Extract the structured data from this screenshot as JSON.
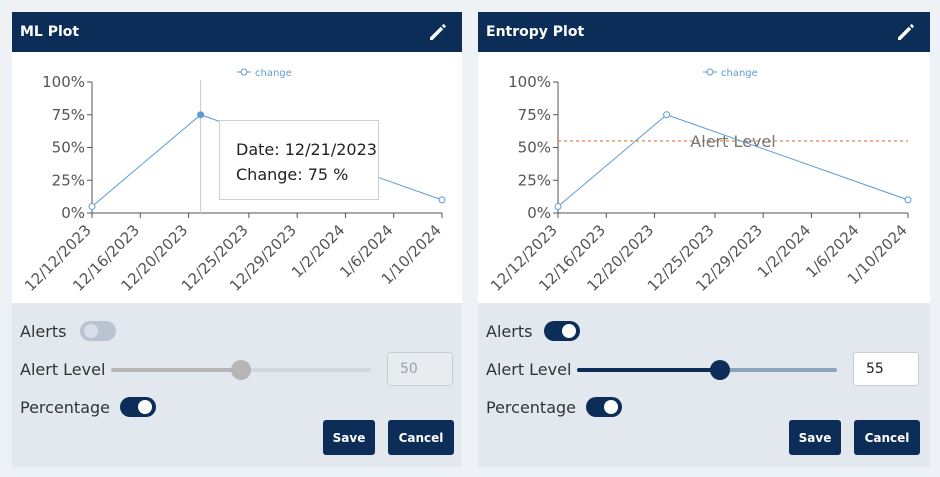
{
  "panels": [
    {
      "title": "ML Plot",
      "edit_icon": "pencil-icon",
      "controls": {
        "alerts_label": "Alerts",
        "alerts_on": false,
        "alert_level_label": "Alert Level",
        "alert_level_value": "50",
        "slider_fraction": 0.5,
        "slider_disabled": true,
        "percentage_label": "Percentage",
        "percentage_on": true,
        "save_label": "Save",
        "cancel_label": "Cancel"
      },
      "tooltip": {
        "date_line": "Date: 12/21/2023",
        "change_line": "Change: 75 %"
      }
    },
    {
      "title": "Entropy Plot",
      "edit_icon": "pencil-icon",
      "controls": {
        "alerts_label": "Alerts",
        "alerts_on": true,
        "alert_level_label": "Alert Level",
        "alert_level_value": "55",
        "slider_fraction": 0.55,
        "slider_disabled": false,
        "percentage_label": "Percentage",
        "percentage_on": true,
        "save_label": "Save",
        "cancel_label": "Cancel"
      }
    }
  ],
  "chart_data": [
    {
      "type": "line",
      "legend": [
        "change"
      ],
      "legend_position": "top-center",
      "series": [
        {
          "name": "change",
          "color": "#5b9bd5",
          "points": [
            {
              "x": "12/12/2023",
              "y": 5
            },
            {
              "x": "12/21/2023",
              "y": 75
            },
            {
              "x": "1/10/2024",
              "y": 10
            }
          ]
        }
      ],
      "x_ticks": [
        "12/12/2023",
        "12/16/2023",
        "12/20/2023",
        "12/25/2023",
        "12/29/2023",
        "1/2/2024",
        "1/6/2024",
        "1/10/2024"
      ],
      "y_ticks": [
        "0%",
        "25%",
        "50%",
        "75%",
        "100%"
      ],
      "ylim": [
        0,
        100
      ],
      "grid": false,
      "highlighted_point": {
        "x": "12/21/2023",
        "y": 75
      },
      "tooltip_lines": [
        "Date: 12/21/2023",
        "Change: 75 %"
      ]
    },
    {
      "type": "line",
      "legend": [
        "change"
      ],
      "legend_position": "top-center",
      "series": [
        {
          "name": "change",
          "color": "#5b9bd5",
          "points": [
            {
              "x": "12/12/2023",
              "y": 5
            },
            {
              "x": "12/21/2023",
              "y": 75
            },
            {
              "x": "1/10/2024",
              "y": 10
            }
          ]
        }
      ],
      "x_ticks": [
        "12/12/2023",
        "12/16/2023",
        "12/20/2023",
        "12/25/2023",
        "12/29/2023",
        "1/2/2024",
        "1/6/2024",
        "1/10/2024"
      ],
      "y_ticks": [
        "0%",
        "25%",
        "50%",
        "75%",
        "100%"
      ],
      "ylim": [
        0,
        100
      ],
      "grid": false,
      "threshold": {
        "label": "Alert Level",
        "y": 55,
        "color": "#e07b39"
      }
    }
  ],
  "colors": {
    "header": "#0b2d57",
    "accent": "#0b2d57",
    "series": "#5b9bd5",
    "threshold": "#e07b39"
  }
}
